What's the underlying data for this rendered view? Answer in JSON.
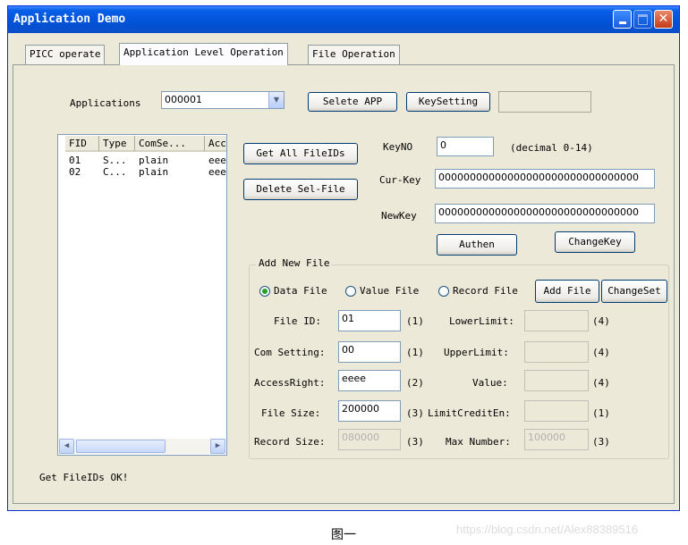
{
  "window": {
    "title": "Application Demo"
  },
  "tabs": [
    {
      "label": "PICC operate"
    },
    {
      "label": "Application Level Operation",
      "active": true
    },
    {
      "label": "File Operation"
    }
  ],
  "applications": {
    "label": "Applications",
    "selected": "000001",
    "select_button": "Selete APP",
    "keysetting_button": "KeySetting",
    "keysetting_value": ""
  },
  "file_list": {
    "columns": [
      "FID",
      "Type",
      "ComSe...",
      "Acc"
    ],
    "rows": [
      [
        "01",
        "S...",
        "plain",
        "eee"
      ],
      [
        "02",
        "C...",
        "plain",
        "eee"
      ]
    ]
  },
  "file_buttons": {
    "get_all": "Get All FileIDs",
    "delete_sel": "Delete Sel-File"
  },
  "keys": {
    "keyno_label": "KeyNO",
    "keyno_value": "0",
    "keyno_hint": "(decimal 0-14)",
    "curkey_label": "Cur-Key",
    "curkey_value": "00000000000000000000000000000000",
    "newkey_label": "NewKey",
    "newkey_value": "00000000000000000000000000000000",
    "authen_button": "Authen",
    "changekey_button": "ChangeKey"
  },
  "add_new_file": {
    "group_title": "Add New File",
    "radio_data": "Data File",
    "radio_value": "Value File",
    "radio_record": "Record File",
    "selected_type": "Data File",
    "add_button": "Add File",
    "changeset_button": "ChangeSet",
    "file_id_label": "File ID:",
    "file_id_value": "01",
    "file_id_unit": "(1)",
    "com_setting_label": "Com Setting:",
    "com_setting_value": "00",
    "com_setting_unit": "(1)",
    "access_right_label": "AccessRight:",
    "access_right_value": "eeee",
    "access_right_unit": "(2)",
    "file_size_label": "File Size:",
    "file_size_value": "200000",
    "file_size_unit": "(3)",
    "record_size_label": "Record Size:",
    "record_size_value": "080000",
    "record_size_unit": "(3)",
    "lower_limit_label": "LowerLimit:",
    "lower_limit_value": "",
    "lower_limit_unit": "(4)",
    "upper_limit_label": "UpperLimit:",
    "upper_limit_value": "",
    "upper_limit_unit": "(4)",
    "value_label": "Value:",
    "value_value": "",
    "value_unit": "(4)",
    "limit_credit_label": "LimitCreditEn:",
    "limit_credit_value": "",
    "limit_credit_unit": "(1)",
    "max_number_label": "Max Number:",
    "max_number_value": "100000",
    "max_number_unit": "(3)"
  },
  "status": {
    "text": "Get FileIDs OK!"
  },
  "figure_caption": "图一",
  "watermark": "https://blog.csdn.net/Alex88389516"
}
